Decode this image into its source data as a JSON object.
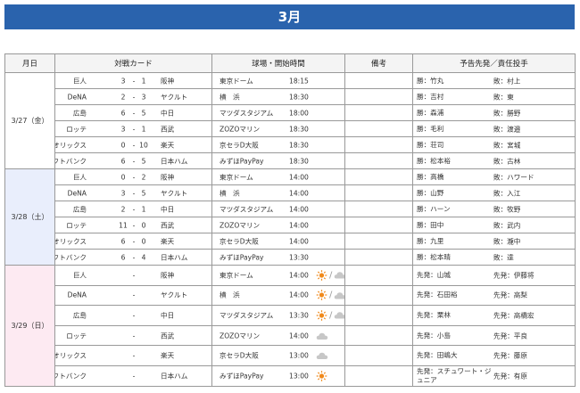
{
  "month_title": "3月",
  "columns": {
    "date": "月日",
    "card": "対戦カード",
    "stadium": "球場・開始時間",
    "note": "備考",
    "pitchers": "予告先発／責任投手"
  },
  "days": [
    {
      "date": "3/27（金）",
      "games": [
        {
          "home": "巨人",
          "s1": "3",
          "s2": "1",
          "away": "阪神",
          "venue": "東京ドーム",
          "time": "18:15",
          "p1": "勝：竹丸",
          "p2": "敗：村上"
        },
        {
          "home": "DeNA",
          "s1": "2",
          "s2": "3",
          "away": "ヤクルト",
          "venue": "横　浜",
          "time": "18:30",
          "p1": "勝：吉村",
          "p2": "敗：東"
        },
        {
          "home": "広島",
          "s1": "6",
          "s2": "5",
          "away": "中日",
          "venue": "マツダスタジアム",
          "time": "18:00",
          "p1": "勝：森浦",
          "p2": "敗：勝野"
        },
        {
          "home": "ロッテ",
          "s1": "3",
          "s2": "1",
          "away": "西武",
          "venue": "ZOZOマリン",
          "time": "18:30",
          "p1": "勝：毛利",
          "p2": "敗：渡邉"
        },
        {
          "home": "オリックス",
          "s1": "0",
          "s2": "10",
          "away": "楽天",
          "venue": "京セラD大阪",
          "time": "18:30",
          "p1": "勝：荘司",
          "p2": "敗：宮城"
        },
        {
          "home": "ソフトバンク",
          "s1": "6",
          "s2": "5",
          "away": "日本ハム",
          "venue": "みずほPayPay",
          "time": "18:30",
          "p1": "勝：松本裕",
          "p2": "敗：古林"
        }
      ]
    },
    {
      "date": "3/28（土）",
      "games": [
        {
          "home": "巨人",
          "s1": "0",
          "s2": "2",
          "away": "阪神",
          "venue": "東京ドーム",
          "time": "14:00",
          "p1": "勝：高橋",
          "p2": "敗：ハワード"
        },
        {
          "home": "DeNA",
          "s1": "3",
          "s2": "5",
          "away": "ヤクルト",
          "venue": "横　浜",
          "time": "14:00",
          "p1": "勝：山野",
          "p2": "敗：入江"
        },
        {
          "home": "広島",
          "s1": "2",
          "s2": "1",
          "away": "中日",
          "venue": "マツダスタジアム",
          "time": "14:00",
          "p1": "勝：ハーン",
          "p2": "敗：牧野"
        },
        {
          "home": "ロッテ",
          "s1": "11",
          "s2": "0",
          "away": "西武",
          "venue": "ZOZOマリン",
          "time": "14:00",
          "p1": "勝：田中",
          "p2": "敗：武内"
        },
        {
          "home": "オリックス",
          "s1": "6",
          "s2": "0",
          "away": "楽天",
          "venue": "京セラD大阪",
          "time": "14:00",
          "p1": "勝：九里",
          "p2": "敗：瀧中"
        },
        {
          "home": "ソフトバンク",
          "s1": "6",
          "s2": "4",
          "away": "日本ハム",
          "venue": "みずほPayPay",
          "time": "13:30",
          "p1": "勝：松本晴",
          "p2": "敗：達"
        }
      ]
    },
    {
      "date": "3/29（日）",
      "games": [
        {
          "home": "巨人",
          "s1": "",
          "s2": "",
          "away": "阪神",
          "venue": "東京ドーム",
          "time": "14:00",
          "weather": [
            "sun-icon",
            "cloud-icon"
          ],
          "p1": "先発：山城",
          "p2": "先発：伊藤将"
        },
        {
          "home": "DeNA",
          "s1": "",
          "s2": "",
          "away": "ヤクルト",
          "venue": "横　浜",
          "time": "14:00",
          "weather": [
            "sun-icon",
            "cloud-icon"
          ],
          "p1": "先発：石田裕",
          "p2": "先発：高梨"
        },
        {
          "home": "広島",
          "s1": "",
          "s2": "",
          "away": "中日",
          "venue": "マツダスタジアム",
          "time": "13:30",
          "weather": [
            "sun-icon",
            "cloud-icon"
          ],
          "p1": "先発：栗林",
          "p2": "先発：高橋宏"
        },
        {
          "home": "ロッテ",
          "s1": "",
          "s2": "",
          "away": "西武",
          "venue": "ZOZOマリン",
          "time": "14:00",
          "weather": [
            "cloud-icon"
          ],
          "p1": "先発：小島",
          "p2": "先発：平良"
        },
        {
          "home": "オリックス",
          "s1": "",
          "s2": "",
          "away": "楽天",
          "venue": "京セラD大阪",
          "time": "13:00",
          "weather": [
            "cloud-icon"
          ],
          "p1": "先発：田嶋大",
          "p2": "先発：藤原"
        },
        {
          "home": "ソフトバンク",
          "s1": "",
          "s2": "",
          "away": "日本ハム",
          "venue": "みずほPayPay",
          "time": "13:00",
          "weather": [
            "sun-icon"
          ],
          "p1": "先発：スチュワート・ジュニア",
          "p2": "先発：有原"
        }
      ]
    }
  ],
  "colors": {
    "header": "#2a63ad",
    "day2": "#e9eefc",
    "day3": "#fdeaf2",
    "sun": "#f08a1c",
    "cloud": "#c7c7c7"
  }
}
